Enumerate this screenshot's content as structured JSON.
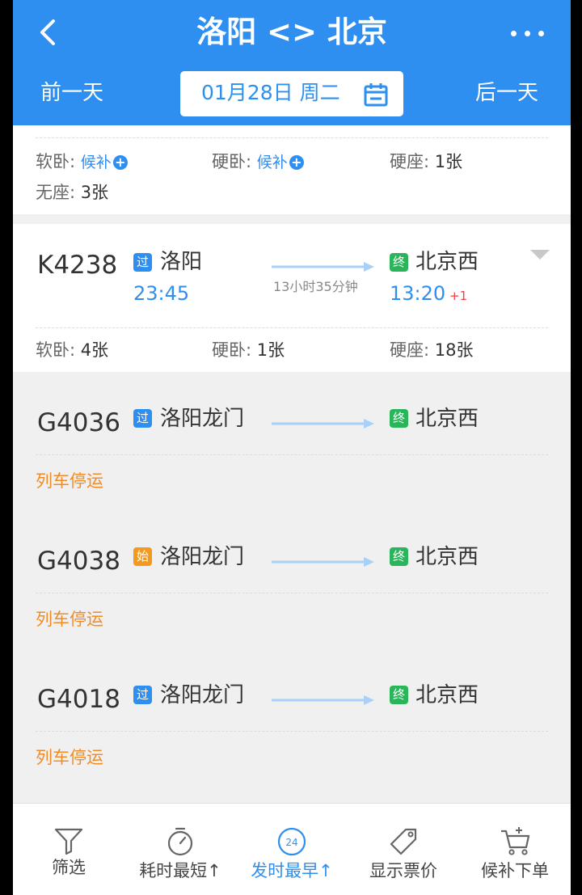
{
  "header": {
    "title": "洛阳 <> 北京",
    "prev_day": "前一天",
    "next_day": "后一天",
    "date": "01月28日 周二"
  },
  "prev_card": {
    "seats": [
      {
        "label": "软卧:",
        "value": "候补"
      },
      {
        "label": "硬卧:",
        "value": "候补"
      },
      {
        "label": "硬座:",
        "value": "1张"
      },
      {
        "label": "无座:",
        "value": "3张"
      }
    ]
  },
  "trains": [
    {
      "number": "K4238",
      "from_badge": "过",
      "from": "洛阳",
      "depart": "23:45",
      "duration": "13小时35分钟",
      "to_badge": "终",
      "to": "北京西",
      "arrive": "13:20",
      "day_offset": "+1",
      "seats": [
        {
          "label": "软卧:",
          "value": "4张"
        },
        {
          "label": "硬卧:",
          "value": "1张"
        },
        {
          "label": "硬座:",
          "value": "18张"
        }
      ]
    },
    {
      "number": "G4036",
      "from_badge": "过",
      "from": "洛阳龙门",
      "to_badge": "终",
      "to": "北京西",
      "status": "列车停运"
    },
    {
      "number": "G4038",
      "from_badge": "始",
      "from": "洛阳龙门",
      "to_badge": "终",
      "to": "北京西",
      "status": "列车停运"
    },
    {
      "number": "G4018",
      "from_badge": "过",
      "from": "洛阳龙门",
      "to_badge": "终",
      "to": "北京西",
      "status": "列车停运"
    }
  ],
  "bottom_bar": {
    "tabs": [
      {
        "label": "筛选",
        "icon": "filter-icon"
      },
      {
        "label": "耗时最短↑",
        "icon": "timer-icon"
      },
      {
        "label": "发时最早↑",
        "icon": "clock-24-icon",
        "icon_text": "24",
        "active": true
      },
      {
        "label": "显示票价",
        "icon": "price-tag-icon"
      },
      {
        "label": "候补下单",
        "icon": "cart-icon"
      }
    ]
  },
  "colors": {
    "primary": "#2f8ff0",
    "suspended": "#f08c28",
    "next_day": "#f04040",
    "badge_pass": "#2f8ff0",
    "badge_start": "#f39a1e",
    "badge_end": "#2ab55a"
  }
}
